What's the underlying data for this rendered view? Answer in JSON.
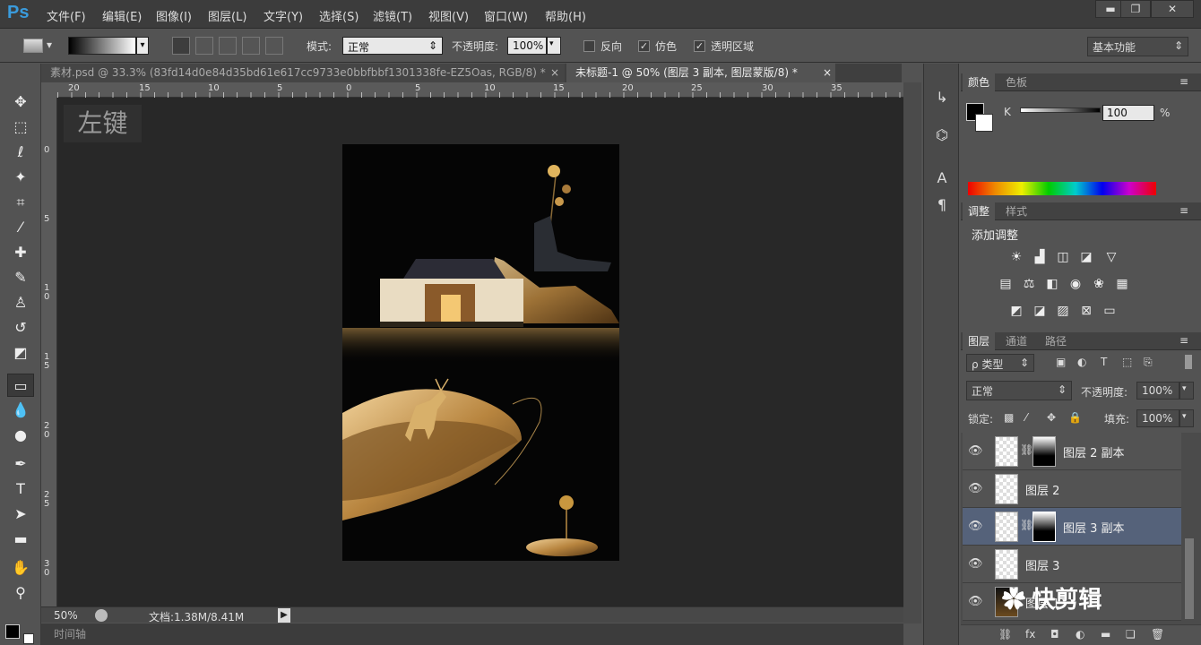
{
  "app": {
    "logo": "Ps"
  },
  "menu": [
    "文件(F)",
    "编辑(E)",
    "图像(I)",
    "图层(L)",
    "文字(Y)",
    "选择(S)",
    "滤镜(T)",
    "视图(V)",
    "窗口(W)",
    "帮助(H)"
  ],
  "window_controls": {
    "minimize": "▬",
    "restore": "❐",
    "close": "✕"
  },
  "options": {
    "mode_label": "模式:",
    "mode_value": "正常",
    "opacity_label": "不透明度:",
    "opacity_value": "100%",
    "reverse_label": "反向",
    "dither_label": "仿色",
    "transparency_label": "透明区域",
    "workspace": "基本功能"
  },
  "tabs": [
    {
      "label": "素材.psd @ 33.3% (83fd14d0e84d35bd61e617cc9733e0bbfbbf1301338fe-EZ5Oas, RGB/8) *",
      "close": "×"
    },
    {
      "label": "未标题-1 @ 50% (图层 3 副本, 图层蒙版/8) *",
      "close": "×"
    }
  ],
  "ruler": {
    "h_labels": [
      "20",
      "15",
      "10",
      "5",
      "0",
      "5",
      "10",
      "15",
      "20",
      "25",
      "30",
      "35"
    ],
    "v_labels": [
      "0",
      "5",
      "1 0",
      "1 5",
      "2 0",
      "2 5",
      "3 0"
    ]
  },
  "overlay": {
    "left_click": "左键"
  },
  "status": {
    "zoom": "50%",
    "doc": "文档:1.38M/8.41M"
  },
  "timeline": {
    "label": "时间轴"
  },
  "color_panel": {
    "tabs": [
      "颜色",
      "色板"
    ],
    "channel": "K",
    "value": "100",
    "unit": "%"
  },
  "adjust_panel": {
    "tabs": [
      "调整",
      "样式"
    ],
    "title": "添加调整",
    "row1": [
      "brightness-icon",
      "levels-icon",
      "curves-icon",
      "exposure-icon",
      "vibrance-icon"
    ],
    "row2": [
      "hue-saturation-icon",
      "color-balance-icon",
      "black-white-icon",
      "photo-filter-icon",
      "channel-mixer-icon",
      "color-lookup-icon"
    ],
    "row3": [
      "invert-icon",
      "posterize-icon",
      "threshold-icon",
      "selective-color-icon",
      "gradient-map-icon"
    ]
  },
  "layers_panel": {
    "tabs": [
      "图层",
      "通道",
      "路径"
    ],
    "filter_label": "ρ 类型",
    "blend_mode": "正常",
    "opacity_label": "不透明度:",
    "opacity_value": "100%",
    "lock_label": "锁定:",
    "fill_label": "填充:",
    "fill_value": "100%",
    "layers": [
      {
        "name": "图层 2 副本",
        "has_mask": true,
        "selected": false
      },
      {
        "name": "图层 2",
        "has_mask": false,
        "selected": false
      },
      {
        "name": "图层 3 副本",
        "has_mask": true,
        "selected": true
      },
      {
        "name": "图层 3",
        "has_mask": false,
        "selected": false
      },
      {
        "name": "图层 1",
        "has_mask": false,
        "selected": false
      }
    ]
  },
  "watermark": "快剪辑",
  "colors": {
    "accent": "#55627a",
    "ps_blue": "#3a9bdc"
  }
}
